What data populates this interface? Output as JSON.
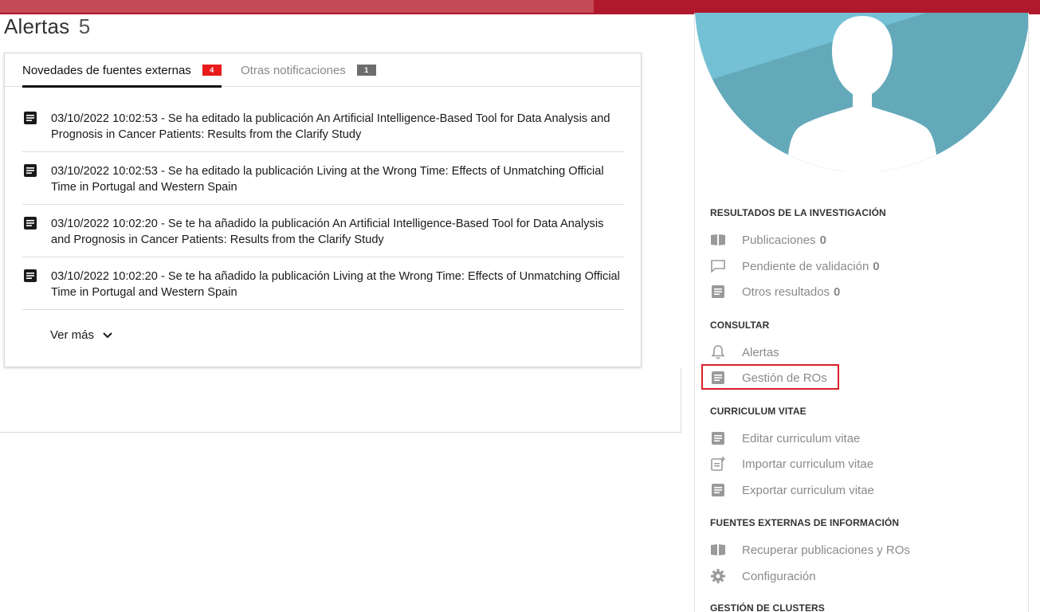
{
  "page": {
    "title": "Alertas",
    "count": "5"
  },
  "tabs": [
    {
      "label": "Novedades de fuentes externas",
      "badge": "4"
    },
    {
      "label": "Otras notificaciones",
      "badge": "1"
    }
  ],
  "alerts": [
    {
      "text": "03/10/2022 10:02:53 - Se ha editado la publicación An Artificial Intelligence-Based Tool for Data Analysis and Prognosis in Cancer Patients: Results from the Clarify Study"
    },
    {
      "text": "03/10/2022 10:02:53 - Se ha editado la publicación Living at the Wrong Time: Effects of Unmatching Official Time in Portugal and Western Spain"
    },
    {
      "text": "03/10/2022 10:02:20 - Se te ha añadido la publicación An Artificial Intelligence-Based Tool for Data Analysis and Prognosis in Cancer Patients: Results from the Clarify Study"
    },
    {
      "text": "03/10/2022 10:02:20 - Se te ha añadido la publicación Living at the Wrong Time: Effects of Unmatching Official Time in Portugal and Western Spain"
    }
  ],
  "ver_mas": "Ver más",
  "sidebar": {
    "sections": {
      "resultados": "RESULTADOS DE LA INVESTIGACIÓN",
      "consultar": "CONSULTAR",
      "curriculum": "CURRICULUM VITAE",
      "fuentes": "FUENTES EXTERNAS DE INFORMACIÓN",
      "clusters": "GESTIÓN DE CLUSTERS"
    },
    "items": {
      "publicaciones": {
        "label": "Publicaciones",
        "count": "0"
      },
      "pendiente": {
        "label": "Pendiente de validación",
        "count": "0"
      },
      "otros": {
        "label": "Otros resultados",
        "count": "0"
      },
      "alertas": {
        "label": "Alertas"
      },
      "gestion_ros": {
        "label": "Gestión de ROs"
      },
      "editar_cv": {
        "label": "Editar curriculum vitae"
      },
      "importar_cv": {
        "label": "Importar curriculum vitae"
      },
      "exportar_cv": {
        "label": "Exportar curriculum vitae"
      },
      "recuperar": {
        "label": "Recuperar publicaciones y ROs"
      },
      "configuracion": {
        "label": "Configuración"
      }
    }
  },
  "colors": {
    "topbar": "#b0182b",
    "badge_red": "#e81a1a",
    "badge_gray": "#6d6d6d",
    "avatar_bg": "#74c1d6",
    "highlight": "#d81f26"
  }
}
